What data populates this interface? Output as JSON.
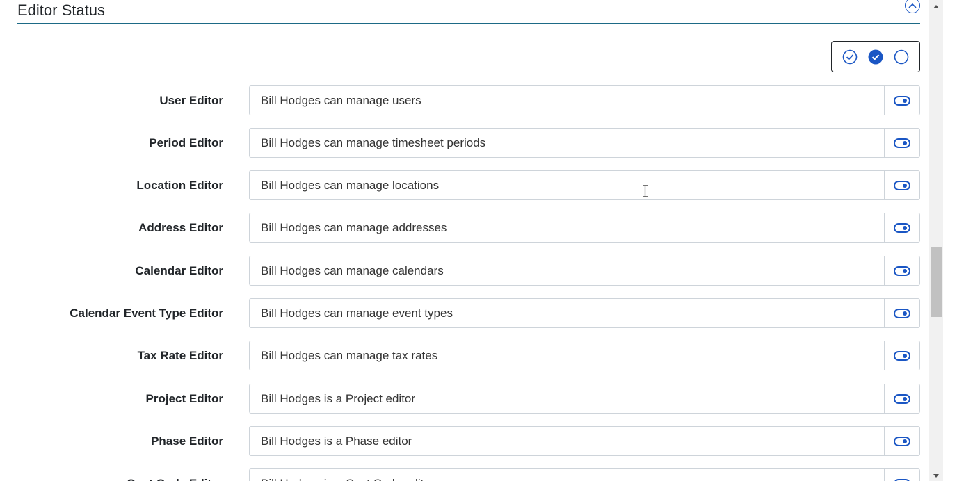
{
  "section": {
    "title": "Editor Status"
  },
  "rows": [
    {
      "label": "User Editor",
      "value": "Bill Hodges can manage users"
    },
    {
      "label": "Period Editor",
      "value": "Bill Hodges can manage timesheet periods"
    },
    {
      "label": "Location Editor",
      "value": "Bill Hodges can manage locations"
    },
    {
      "label": "Address Editor",
      "value": "Bill Hodges can manage addresses"
    },
    {
      "label": "Calendar Editor",
      "value": "Bill Hodges can manage calendars"
    },
    {
      "label": "Calendar Event Type Editor",
      "value": "Bill Hodges can manage event types"
    },
    {
      "label": "Tax Rate Editor",
      "value": "Bill Hodges can manage tax rates"
    },
    {
      "label": "Project Editor",
      "value": "Bill Hodges is a Project editor"
    },
    {
      "label": "Phase Editor",
      "value": "Bill Hodges is a Phase editor"
    },
    {
      "label": "Cost Code Editor",
      "value": "Bill Hodges is a Cost Code editor"
    }
  ],
  "toggles_enabled": [
    true,
    true,
    true,
    true,
    true,
    true,
    true,
    true,
    true,
    true
  ],
  "icons": {
    "collapse": "chevron-up-circle-icon",
    "select_all": "check-circle-outline-icon",
    "select_filled": "check-circle-filled-icon",
    "select_none": "circle-outline-icon",
    "toggle": "toggle-on-icon"
  },
  "colors": {
    "accent": "#1a56c4",
    "header_rule": "#1d6a86",
    "input_border": "#ced4da"
  }
}
